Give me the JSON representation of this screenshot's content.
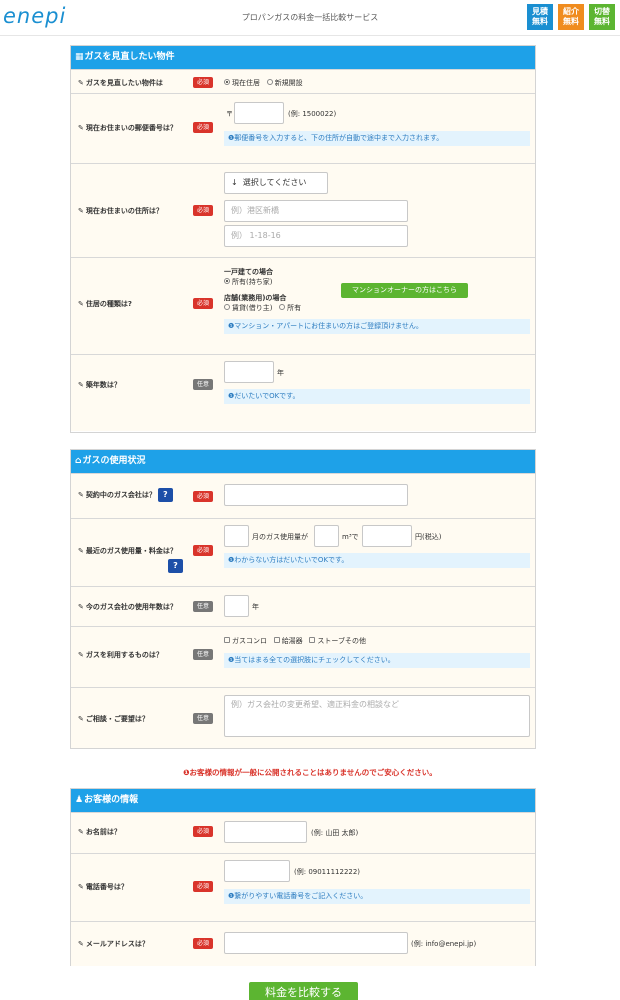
{
  "header": {
    "logo": "enepi",
    "title": "プロパンガスの料金一括比較サービス",
    "buttons": [
      {
        "label": "見積\n無料",
        "line1": "見積",
        "line2": "無料"
      },
      {
        "label": "紹介\n無料",
        "line1": "紹介",
        "line2": "無料"
      },
      {
        "label": "切替\n無料",
        "line1": "切替",
        "line2": "無料"
      }
    ]
  },
  "section1": {
    "title": "ガスを見直したい物件",
    "q_property": "ガスを見直したい物件は",
    "property_opt1": "現在住居",
    "property_opt2": "新規開設",
    "q_zip": "現在お住まいの郵便番号は？",
    "zip_mark": "〒",
    "zip_example": "(例: 1500022)",
    "zip_note": "郵便番号を入力すると、下の住所が自動で途中まで入力されます。",
    "q_address": "現在お住まいの住所は？",
    "pref_select": "選択してください",
    "address1_placeholder": "例）港区新橋",
    "address2_placeholder": "例） 1-18-16",
    "q_type": "住居の種類は?",
    "house_label": "一戸建ての場合",
    "house_opt": "所有(持ち家)",
    "shop_label": "店舗(業務用)の場合",
    "shop_opt1": "賃貸(借り主)",
    "shop_opt2": "所有",
    "mansion_button": "マンションオーナーの方はこちら",
    "type_note": "マンション・アパートにお住まいの方はご登録頂けません。",
    "q_age": "築年数は？",
    "age_unit": "年",
    "age_note": "だいたいでOKです。"
  },
  "section2": {
    "title": "ガスの使用状況",
    "q_company": "契約中のガス会社は？",
    "q_usage": "最近のガス使用量・料金は？",
    "usage_t1": "月のガス使用量が",
    "usage_t2": "m³で",
    "usage_t3": "円(税込)",
    "usage_note": "わからない方はだいたいでOKです。",
    "q_years": "今のガス会社の使用年数は？",
    "years_unit": "年",
    "q_uses": "ガスを利用するものは？",
    "use1": "ガスコンロ",
    "use2": "給湯器",
    "use3": "ストーブその他",
    "uses_note": "当てはまる全ての選択肢にチェックしてください。",
    "q_request": "ご相談・ご要望は？",
    "request_placeholder": "例）ガス会社の変更希望、適正料金の相談など"
  },
  "warning": "お客様の情報が一般に公開されることはありませんのでご安心ください。",
  "section3": {
    "title": "お客様の情報",
    "q_name": "お名前は？",
    "name_example": "(例: 山田 太郎)",
    "q_phone": "電話番号は？",
    "phone_example": "(例: 09011112222)",
    "phone_note": "繋がりやすい電話番号をご記入ください。",
    "q_email": "メールアドレスは？",
    "email_example": "(例: info@enepi.jp)"
  },
  "badges": {
    "required": "必須",
    "optional": "任意",
    "help": "?"
  },
  "submit": "料金を比較する",
  "colors": {
    "accent": "#1ea1e8",
    "required": "#d9342b",
    "green": "#5cb531",
    "orange": "#f08c1e"
  }
}
